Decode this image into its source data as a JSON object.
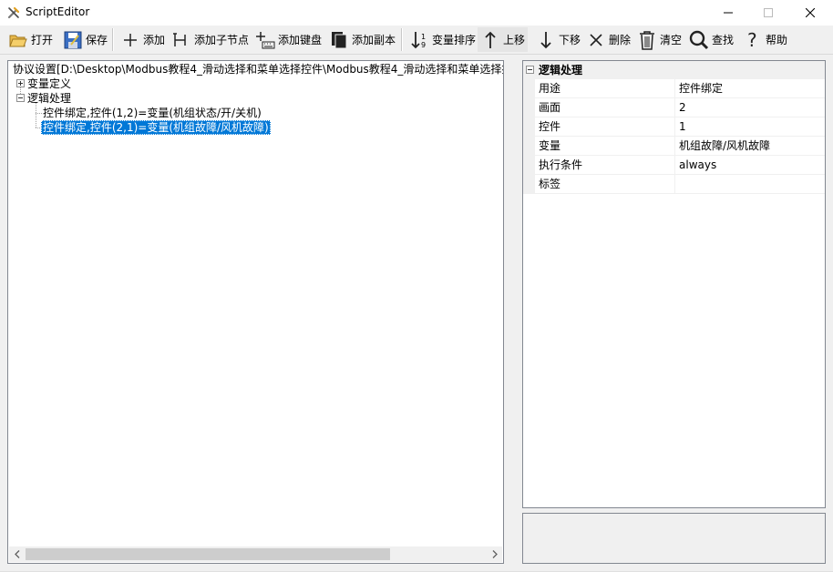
{
  "window": {
    "title": "ScriptEditor",
    "controls": {
      "minimize_icon": "minimize-icon",
      "maximize_icon": "maximize-icon",
      "close_icon": "close-icon"
    }
  },
  "toolbar": {
    "open": "打开",
    "save": "保存",
    "add": "添加",
    "add_child": "添加子节点",
    "add_keyboard": "添加键盘",
    "add_copy": "添加副本",
    "sort_vars": "变量排序",
    "move_up": "上移",
    "move_down": "下移",
    "delete": "删除",
    "clear": "清空",
    "find": "查找",
    "help": "帮助"
  },
  "tree": {
    "root": "协议设置[D:\\Desktop\\Modbus教程4_滑动选择和菜单选择控件\\Modbus教程4_滑动选择和菜单选择控",
    "var_def": "变量定义",
    "logic": "逻辑处理",
    "children": [
      {
        "label": "控件绑定,控件(1,2)=变量(机组状态/开/关机)"
      },
      {
        "label": "控件绑定,控件(2,1)=变量(机组故障/风机故障)"
      }
    ]
  },
  "properties": {
    "category": "逻辑处理",
    "rows": [
      {
        "name": "用途",
        "value": "控件绑定"
      },
      {
        "name": "画面",
        "value": "2"
      },
      {
        "name": "控件",
        "value": "1"
      },
      {
        "name": "变量",
        "value": "机组故障/风机故障"
      },
      {
        "name": "执行条件",
        "value": "always"
      },
      {
        "name": "标签",
        "value": ""
      }
    ]
  }
}
